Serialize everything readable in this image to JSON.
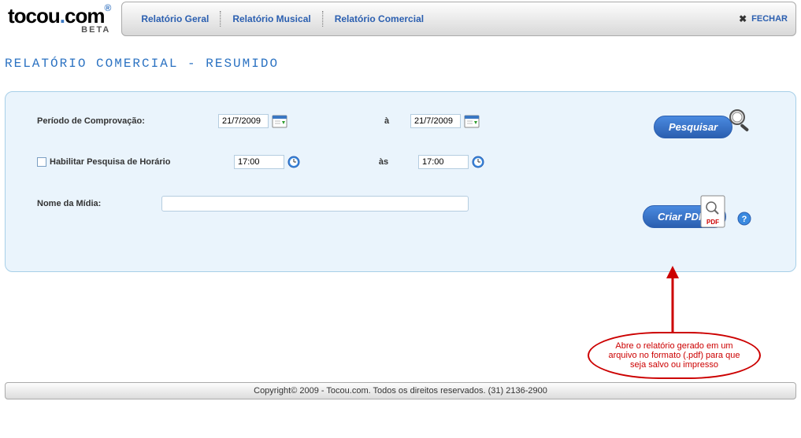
{
  "logo": {
    "brand_main": "tocou",
    "brand_dot": ".",
    "brand_suffix": "com",
    "reg": "®",
    "beta": "BETA"
  },
  "topnav": {
    "items": [
      "Relatório Geral",
      "Relatório Musical",
      "Relatório Comercial"
    ],
    "close_label": "FECHAR"
  },
  "page_title": "RELATÓRIO COMERCIAL - RESUMIDO",
  "form": {
    "periodo_label": "Período de Comprovação:",
    "date_from": "21/7/2009",
    "date_to": "21/7/2009",
    "a_label": "à",
    "habilitar_label": "Habilitar Pesquisa de Horário",
    "time_from": "17:00",
    "time_to": "17:00",
    "as_label": "às",
    "nome_midia_label": "Nome da Mídia:",
    "nome_midia_value": ""
  },
  "buttons": {
    "pesquisar": "Pesquisar",
    "criar_pdf": "Criar PDF"
  },
  "annotation": "Abre o relatório gerado em um arquivo no formato (.pdf) para que seja salvo ou impresso",
  "footer": "Copyright© 2009 - Tocou.com. Todos os direitos reservados. (31) 2136-2900"
}
